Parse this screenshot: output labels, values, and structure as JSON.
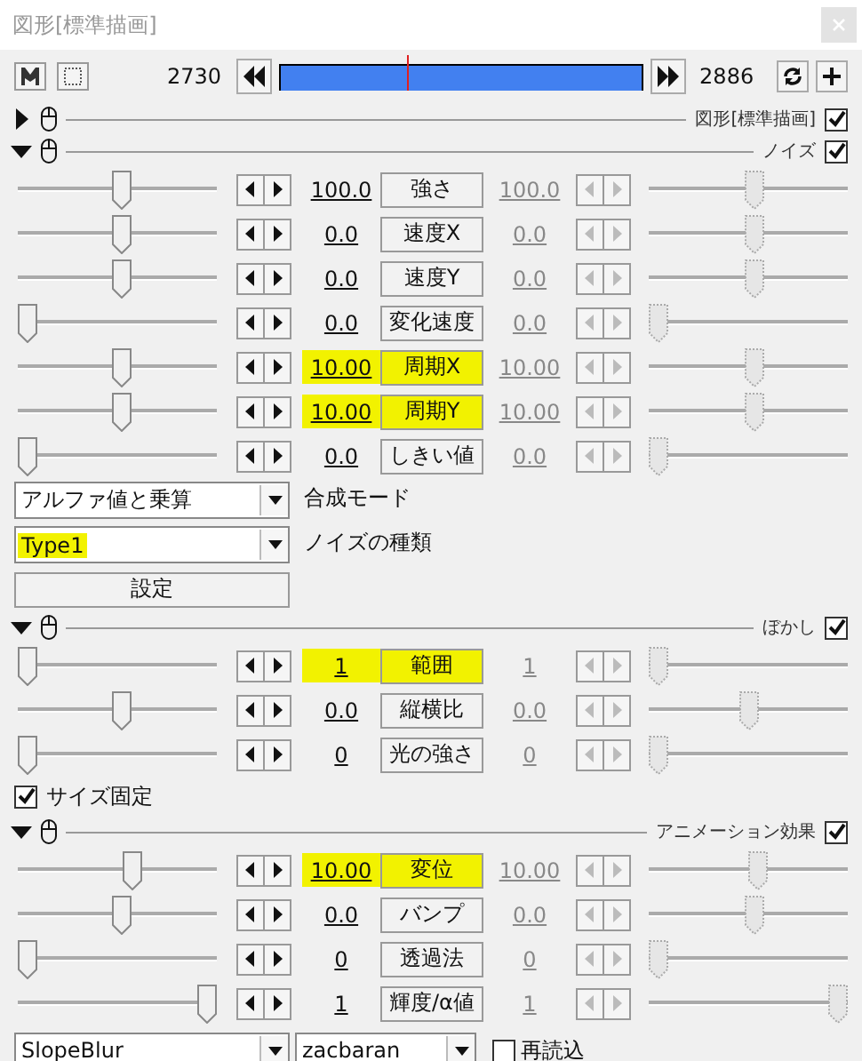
{
  "window": {
    "title": "図形[標準描画]"
  },
  "toolbar": {
    "start_frame": "2730",
    "end_frame": "2886",
    "timeline": {
      "level": 0.35
    }
  },
  "sections": [
    {
      "title": "図形[標準描画]",
      "expanded": false,
      "enabled": true
    },
    {
      "title": "ノイズ",
      "expanded": true,
      "enabled": true,
      "rows": [
        {
          "label": "強さ",
          "start": "100.0",
          "end": "100.0",
          "highlighted": false,
          "left_slider": {
            "level": 0.52
          },
          "right_slider": {
            "level": 0.53
          }
        },
        {
          "label": "速度X",
          "start": "0.0",
          "end": "0.0",
          "highlighted": false,
          "left_slider": {
            "level": 0.52
          },
          "right_slider": {
            "level": 0.53
          }
        },
        {
          "label": "速度Y",
          "start": "0.0",
          "end": "0.0",
          "highlighted": false,
          "left_slider": {
            "level": 0.52
          },
          "right_slider": {
            "level": 0.53
          }
        },
        {
          "label": "変化速度",
          "start": "0.0",
          "end": "0.0",
          "highlighted": false,
          "left_slider": {
            "level": 0.0
          },
          "right_slider": {
            "level": 0.0
          }
        },
        {
          "label": "周期X",
          "start": "10.00",
          "end": "10.00",
          "highlighted": true,
          "left_slider": {
            "level": 0.52
          },
          "right_slider": {
            "level": 0.53
          }
        },
        {
          "label": "周期Y",
          "start": "10.00",
          "end": "10.00",
          "highlighted": true,
          "left_slider": {
            "level": 0.52
          },
          "right_slider": {
            "level": 0.53
          }
        },
        {
          "label": "しきい値",
          "start": "0.0",
          "end": "0.0",
          "highlighted": false,
          "left_slider": {
            "level": 0.0
          },
          "right_slider": {
            "level": 0.0
          }
        }
      ],
      "extras": [
        {
          "kind": "dropdown",
          "value": "アルファ値と乗算",
          "label": "合成モード",
          "highlighted": false
        },
        {
          "kind": "dropdown",
          "value": "Type1",
          "label": "ノイズの種類",
          "highlighted": true
        },
        {
          "kind": "button",
          "label": "設定"
        }
      ]
    },
    {
      "title": "ぼかし",
      "expanded": true,
      "enabled": true,
      "rows": [
        {
          "label": "範囲",
          "start": "1",
          "end": "1",
          "highlighted": true,
          "left_slider": {
            "level": 0.0
          },
          "right_slider": {
            "level": 0.0
          }
        },
        {
          "label": "縦横比",
          "start": "0.0",
          "end": "0.0",
          "highlighted": false,
          "left_slider": {
            "level": 0.52
          },
          "right_slider": {
            "level": 0.5
          }
        },
        {
          "label": "光の強さ",
          "start": "0",
          "end": "0",
          "highlighted": false,
          "left_slider": {
            "level": 0.0
          },
          "right_slider": {
            "level": 0.0
          }
        }
      ],
      "extras": [
        {
          "kind": "checkbox",
          "label": "サイズ固定",
          "checked": true
        }
      ]
    },
    {
      "title": "アニメーション効果",
      "expanded": true,
      "enabled": true,
      "rows": [
        {
          "label": "変位",
          "start": "10.00",
          "end": "10.00",
          "highlighted": true,
          "left_slider": {
            "level": 0.58
          },
          "right_slider": {
            "level": 0.55
          }
        },
        {
          "label": "バンプ",
          "start": "0.0",
          "end": "0.0",
          "highlighted": false,
          "left_slider": {
            "level": 0.52
          },
          "right_slider": {
            "level": 0.53
          }
        },
        {
          "label": "透過法",
          "start": "0",
          "end": "0",
          "highlighted": false,
          "left_slider": {
            "level": 0.0
          },
          "right_slider": {
            "level": 0.0
          }
        },
        {
          "label": "輝度/α値",
          "start": "1",
          "end": "1",
          "highlighted": false,
          "left_slider": {
            "level": 1.0
          },
          "right_slider": {
            "level": 1.0
          }
        }
      ],
      "extras": [
        {
          "kind": "selector_row",
          "dropdowns": [
            "SlopeBlur",
            "zacbaran"
          ],
          "checkbox": {
            "label": "再読込",
            "checked": false
          }
        }
      ]
    }
  ]
}
